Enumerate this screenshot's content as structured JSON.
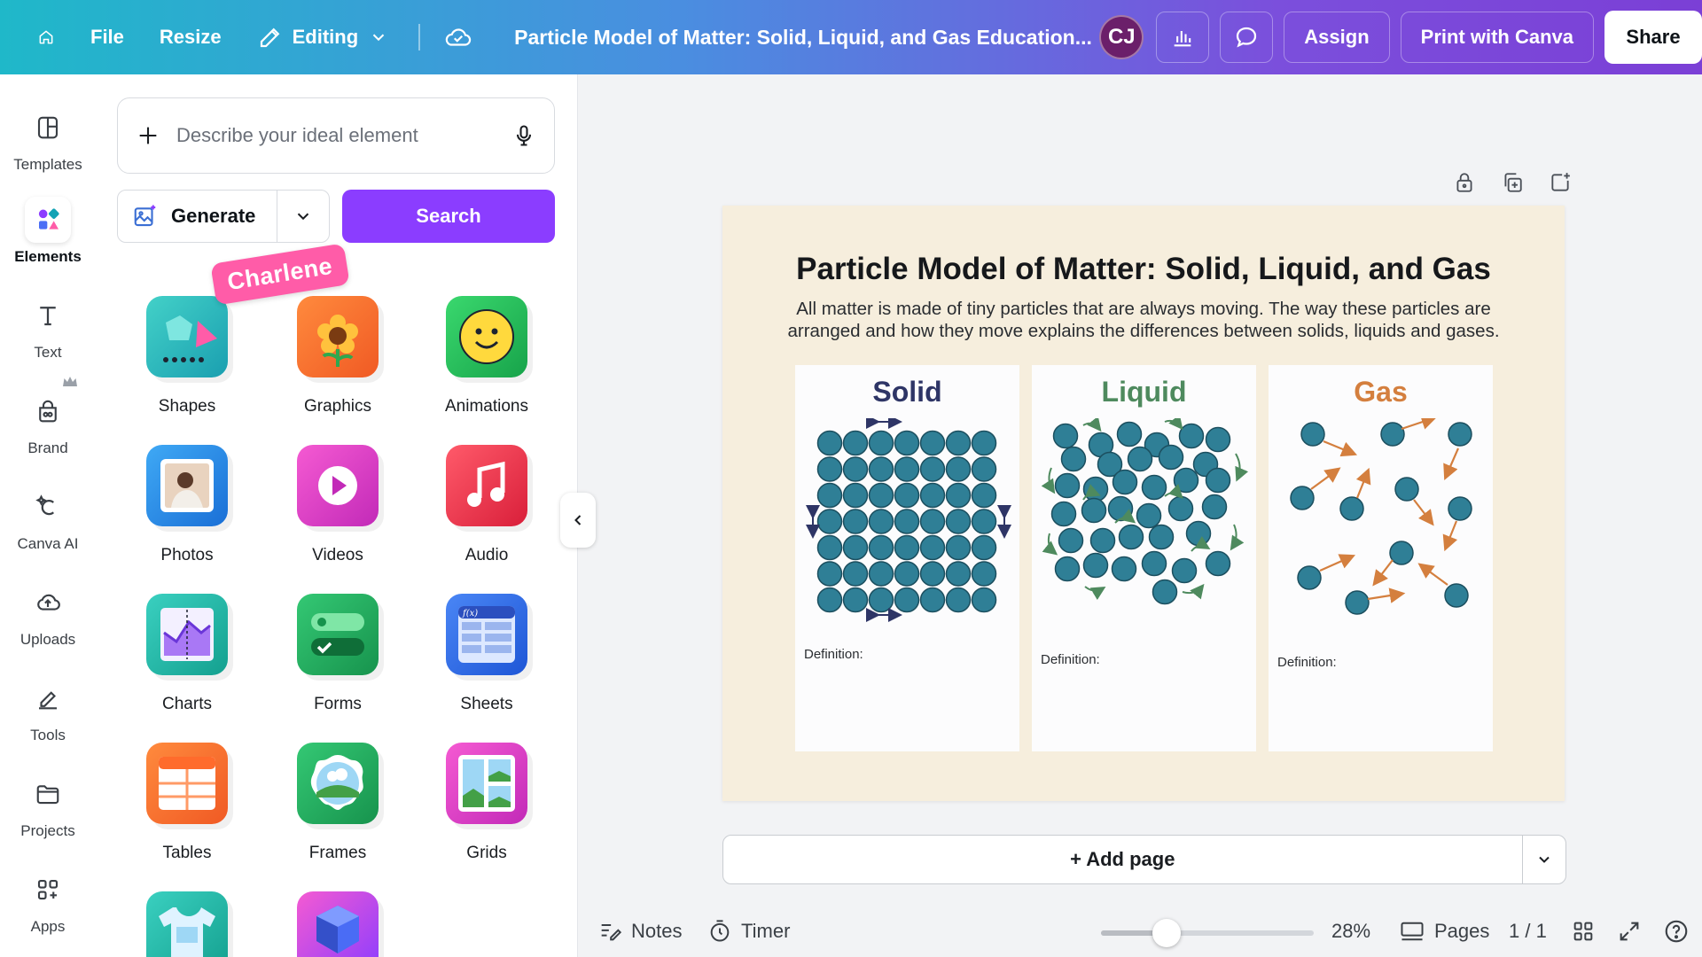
{
  "topbar": {
    "file_label": "File",
    "resize_label": "Resize",
    "mode_label": "Editing",
    "document_title": "Particle Model of Matter: Solid, Liquid, and Gas Education...",
    "avatar_initials": "CJ",
    "assign_label": "Assign",
    "print_label": "Print with Canva",
    "share_label": "Share"
  },
  "rail": {
    "items": [
      {
        "label": "Templates",
        "icon": "templates-icon"
      },
      {
        "label": "Elements",
        "icon": "elements-icon",
        "active": true
      },
      {
        "label": "Text",
        "icon": "text-icon"
      },
      {
        "label": "Brand",
        "icon": "brand-icon"
      },
      {
        "label": "Canva AI",
        "icon": "canva-ai-icon"
      },
      {
        "label": "Uploads",
        "icon": "uploads-icon"
      },
      {
        "label": "Tools",
        "icon": "tools-icon"
      },
      {
        "label": "Projects",
        "icon": "projects-icon"
      },
      {
        "label": "Apps",
        "icon": "apps-icon"
      }
    ]
  },
  "panel": {
    "search_placeholder": "Describe your ideal element",
    "generate_label": "Generate",
    "search_button": "Search",
    "collaborator_tag": "Charlene",
    "tiles": [
      {
        "label": "Shapes"
      },
      {
        "label": "Graphics"
      },
      {
        "label": "Animations"
      },
      {
        "label": "Photos"
      },
      {
        "label": "Videos"
      },
      {
        "label": "Audio"
      },
      {
        "label": "Charts"
      },
      {
        "label": "Forms"
      },
      {
        "label": "Sheets"
      },
      {
        "label": "Tables"
      },
      {
        "label": "Frames"
      },
      {
        "label": "Grids"
      }
    ]
  },
  "design": {
    "title": "Particle Model of Matter: Solid, Liquid, and Gas",
    "description": "All matter is made of tiny particles that are always moving. The way these particles are arranged and how they move explains the differences between solids, liquids and gases.",
    "cards": [
      {
        "title": "Solid",
        "color": "#2e3566",
        "definition_label": "Definition:"
      },
      {
        "title": "Liquid",
        "color": "#4e8a5e",
        "definition_label": "Definition:"
      },
      {
        "title": "Gas",
        "color": "#d47f3e",
        "definition_label": "Definition:"
      }
    ],
    "particle_color": "#2f7f96",
    "add_page_label": "+ Add page"
  },
  "bottombar": {
    "notes_label": "Notes",
    "timer_label": "Timer",
    "zoom_percent": 28,
    "zoom_label": "28%",
    "pages_label": "Pages",
    "page_counter": "1 / 1"
  },
  "colors": {
    "accent": "#8b3dff",
    "topbar_gradient_start": "#1fb8c9",
    "topbar_gradient_end": "#7b3fd6"
  }
}
